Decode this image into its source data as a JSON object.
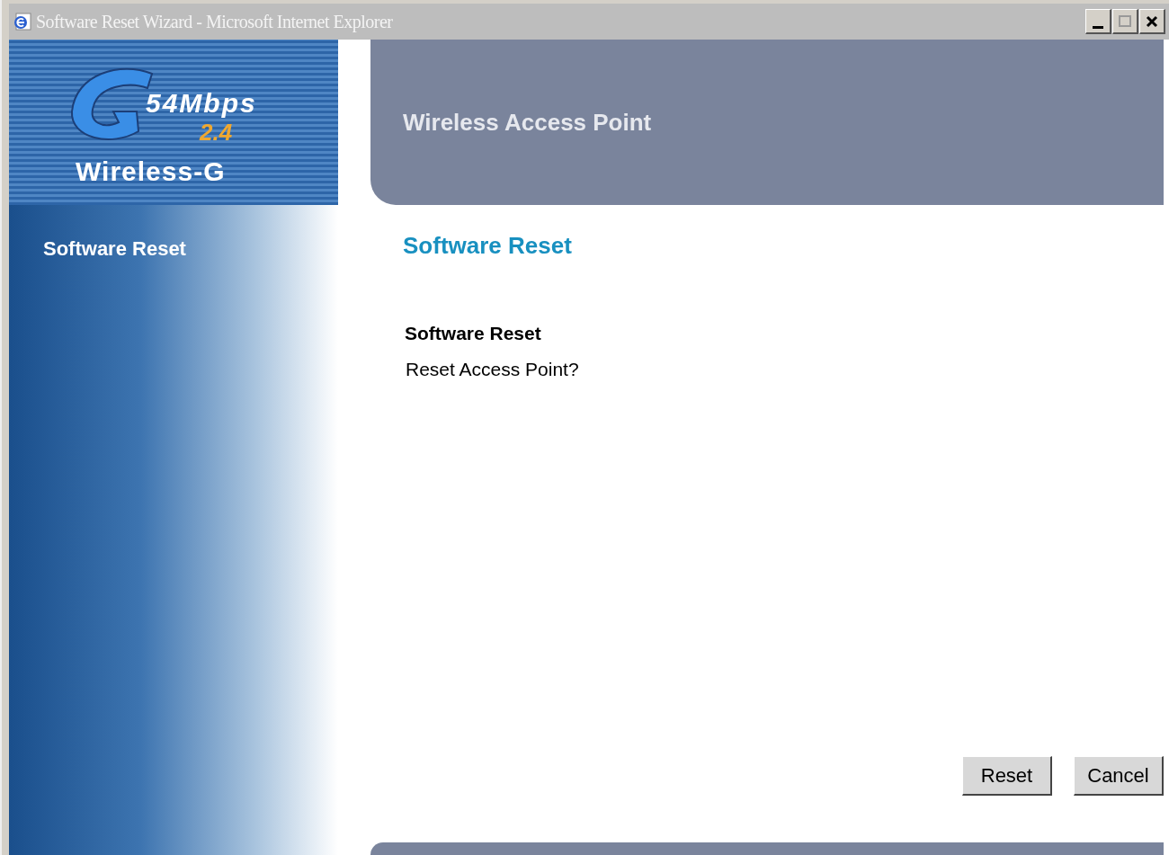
{
  "window": {
    "title": "Software Reset Wizard - Microsoft Internet Explorer"
  },
  "logo": {
    "speed": "54Mbps",
    "band": "2.4",
    "brand": "Wireless-G"
  },
  "header": {
    "title": "Wireless Access Point"
  },
  "sidebar": {
    "items": [
      {
        "label": "Software Reset"
      }
    ]
  },
  "page": {
    "heading": "Software Reset",
    "section_title": "Software Reset",
    "question": "Reset Access Point?"
  },
  "buttons": [
    {
      "label": "Reset"
    },
    {
      "label": "Cancel"
    }
  ]
}
